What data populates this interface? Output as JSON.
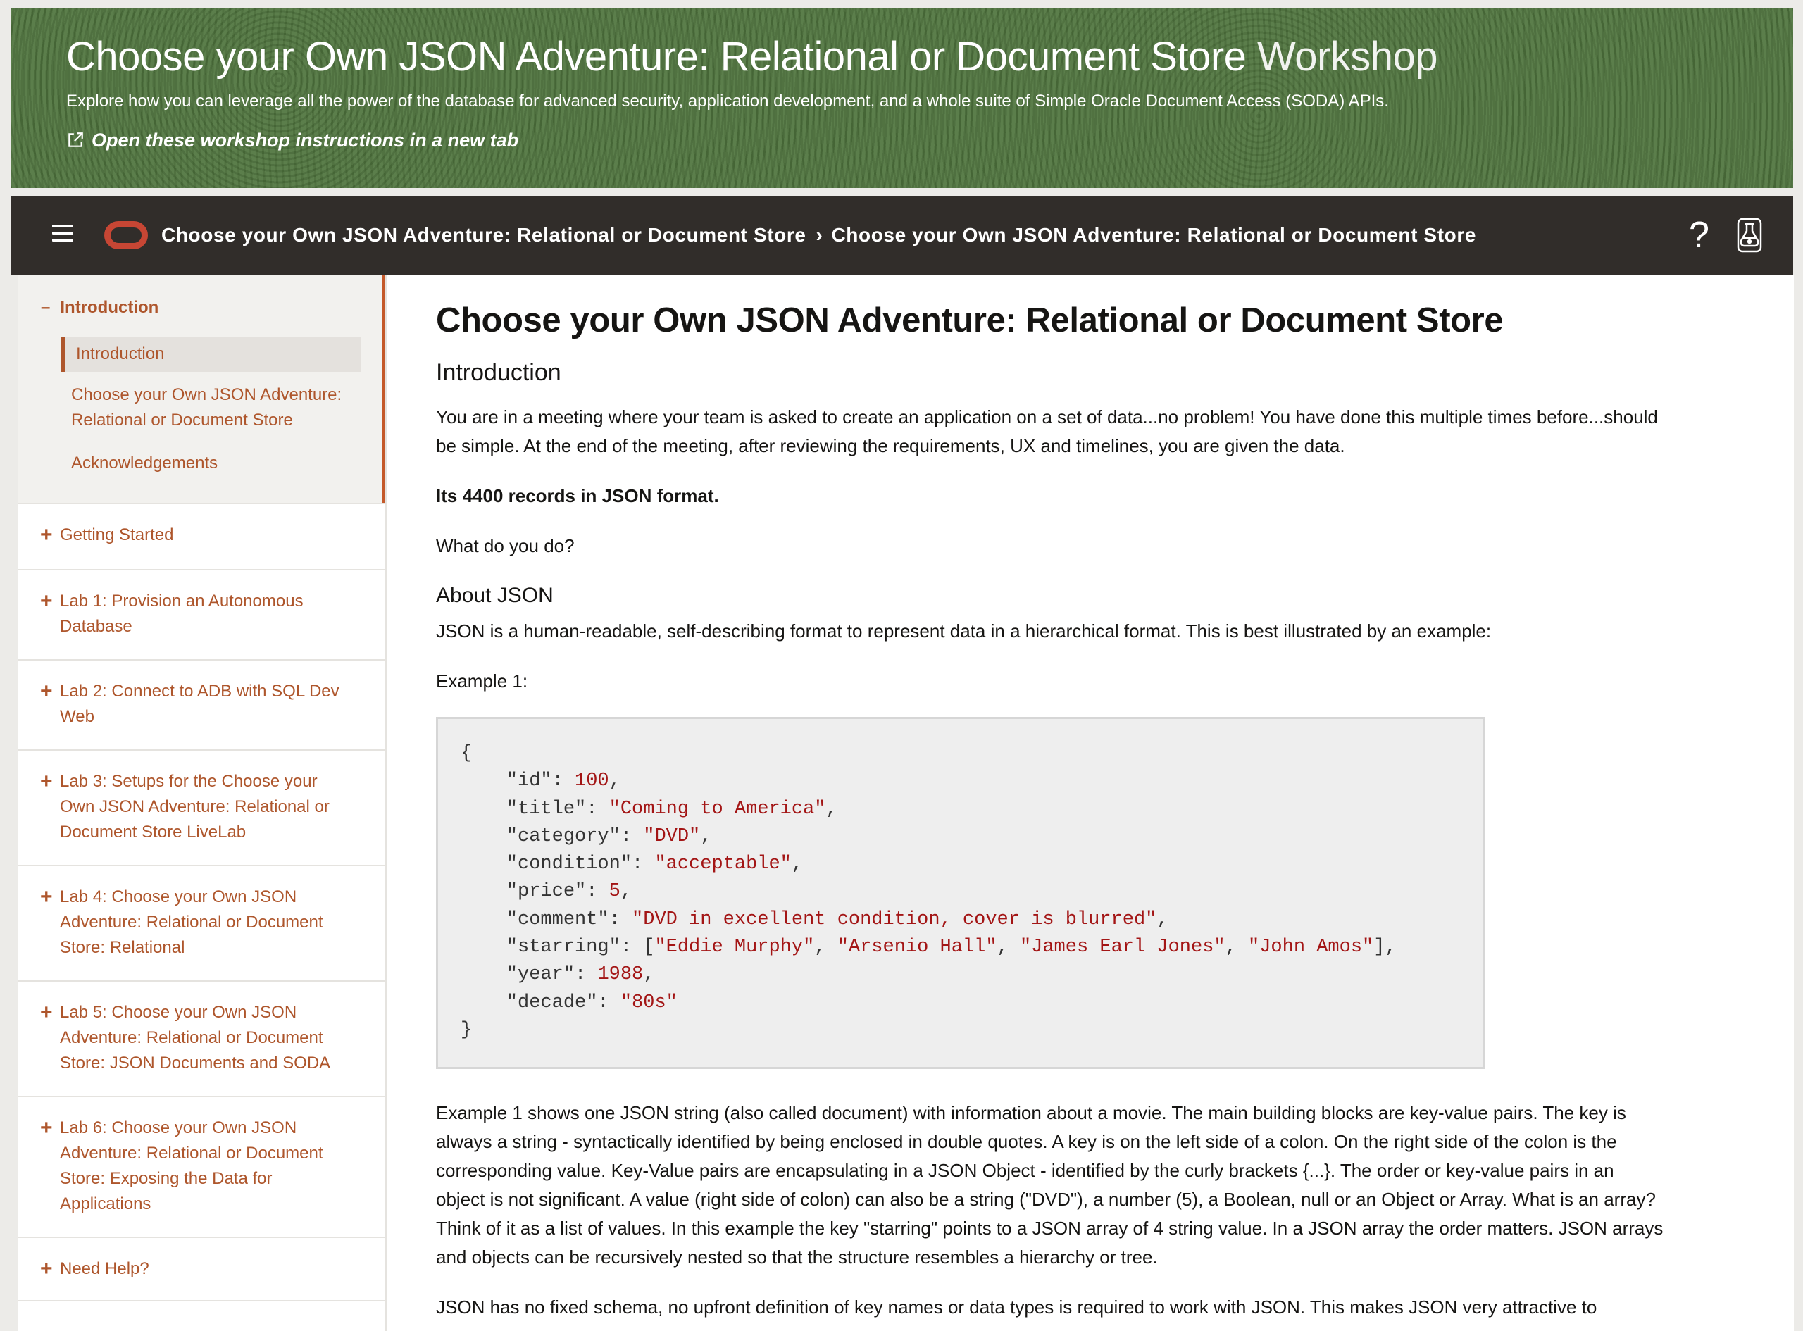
{
  "banner": {
    "title": "Choose your Own JSON Adventure: Relational or Document Store",
    "title_suffix": "Workshop",
    "description": "Explore how you can leverage all the power of the database for advanced security, application development, and a whole suite of Simple Oracle Document Access (SODA) APIs.",
    "new_tab_link": "Open these workshop instructions in a new tab",
    "background_color": "#51763f"
  },
  "topnav": {
    "breadcrumb_1": "Choose your Own JSON Adventure: Relational or Document Store",
    "separator": "›",
    "breadcrumb_2": "Choose your Own JSON Adventure: Relational or Document Store",
    "help_symbol": "?",
    "background_color": "#312d2a",
    "logo_color": "#c74634"
  },
  "sidebar": {
    "intro_toggle": "–",
    "intro_heading": "Introduction",
    "intro_active": "Introduction",
    "intro_items": [
      "Choose your Own JSON Adventure:",
      "Relational or Document Store",
      "Acknowledgements"
    ],
    "plus": "+",
    "groups": [
      {
        "lines": [
          "Getting Started"
        ]
      },
      {
        "lines": [
          "Lab 1: Provision an Autonomous",
          "Database"
        ]
      },
      {
        "lines": [
          "Lab 2: Connect to ADB with SQL Dev",
          "Web"
        ]
      },
      {
        "lines": [
          "Lab 3: Setups for the Choose your",
          "Own JSON Adventure: Relational or",
          "Document Store LiveLab"
        ]
      },
      {
        "lines": [
          "Lab 4: Choose your Own JSON",
          "Adventure: Relational or Document",
          "Store: Relational"
        ]
      },
      {
        "lines": [
          "Lab 5: Choose your Own JSON",
          "Adventure: Relational or Document",
          "Store: JSON Documents and SODA"
        ]
      },
      {
        "lines": [
          "Lab 6: Choose your Own JSON",
          "Adventure: Relational or Document",
          "Store: Exposing the Data for",
          "Applications"
        ]
      },
      {
        "lines": [
          "Need Help?"
        ]
      }
    ],
    "accent_color": "#ae562c"
  },
  "content": {
    "title": "Choose your Own JSON Adventure: Relational or Document Store",
    "intro_heading": "Introduction",
    "intro_text_1": "You are in a meeting where your team is asked to create an application on a set of data...no problem! You have done this multiple times before...should",
    "intro_text_2": "be simple. At the end of the meeting, after reviewing the requirements, UX and timelines, you are given the data.",
    "records": "Its 4400 records in JSON format.",
    "question": "What do you do?",
    "about_heading": "About JSON",
    "about_text": "JSON is a human-readable, self-describing format to represent data in a hierarchical format. This is best illustrated by an example:",
    "example_label": "Example 1:",
    "code_lines": [
      [
        {
          "t": "{",
          "c": "k"
        }
      ],
      [
        {
          "t": "    \"id\": ",
          "c": "k"
        },
        {
          "t": "100",
          "c": "n"
        },
        {
          "t": ",",
          "c": "k"
        }
      ],
      [
        {
          "t": "    \"title\": ",
          "c": "k"
        },
        {
          "t": "\"Coming to America\"",
          "c": "s"
        },
        {
          "t": ",",
          "c": "k"
        }
      ],
      [
        {
          "t": "    \"category\": ",
          "c": "k"
        },
        {
          "t": "\"DVD\"",
          "c": "s"
        },
        {
          "t": ",",
          "c": "k"
        }
      ],
      [
        {
          "t": "    \"condition\": ",
          "c": "k"
        },
        {
          "t": "\"acceptable\"",
          "c": "s"
        },
        {
          "t": ",",
          "c": "k"
        }
      ],
      [
        {
          "t": "    \"price\": ",
          "c": "k"
        },
        {
          "t": "5",
          "c": "n"
        },
        {
          "t": ",",
          "c": "k"
        }
      ],
      [
        {
          "t": "    \"comment\": ",
          "c": "k"
        },
        {
          "t": "\"DVD in excellent condition, cover is blurred\"",
          "c": "s"
        },
        {
          "t": ",",
          "c": "k"
        }
      ],
      [
        {
          "t": "    \"starring\": [",
          "c": "k"
        },
        {
          "t": "\"Eddie Murphy\"",
          "c": "s"
        },
        {
          "t": ", ",
          "c": "k"
        },
        {
          "t": "\"Arsenio Hall\"",
          "c": "s"
        },
        {
          "t": ", ",
          "c": "k"
        },
        {
          "t": "\"James Earl Jones\"",
          "c": "s"
        },
        {
          "t": ", ",
          "c": "k"
        },
        {
          "t": "\"John Amos\"",
          "c": "s"
        },
        {
          "t": "],",
          "c": "k"
        }
      ],
      [
        {
          "t": "    \"year\": ",
          "c": "k"
        },
        {
          "t": "1988",
          "c": "n"
        },
        {
          "t": ",",
          "c": "k"
        }
      ],
      [
        {
          "t": "    \"decade\": ",
          "c": "k"
        },
        {
          "t": "\"80s\"",
          "c": "s"
        }
      ],
      [
        {
          "t": "}",
          "c": "k"
        }
      ]
    ],
    "explain_lines": [
      "Example 1 shows one JSON string (also called document) with information about a movie. The main building blocks are key-value pairs. The key is",
      "always a string - syntactically identified by being enclosed in double quotes. A key is on the left side of a colon. On the right side of the colon is the",
      "corresponding value. Key-Value pairs are encapsulating in a JSON Object - identified by the curly brackets {...}. The order or key-value pairs in an",
      "object is not significant. A value (right side of colon) can also be a string (\"DVD\"), a number (5), a Boolean, null or an Object or Array. What is an array?",
      "Think of it as a list of values. In this example the key \"starring\" points to a JSON array of 4 string value. In a JSON array the order matters. JSON arrays",
      "and objects can be recursively nested so that the structure resembles a hierarchy or tree."
    ],
    "schema_text": "JSON has no fixed schema, no upfront definition of key names or data types is required to work with JSON. This makes JSON very attractive to"
  }
}
